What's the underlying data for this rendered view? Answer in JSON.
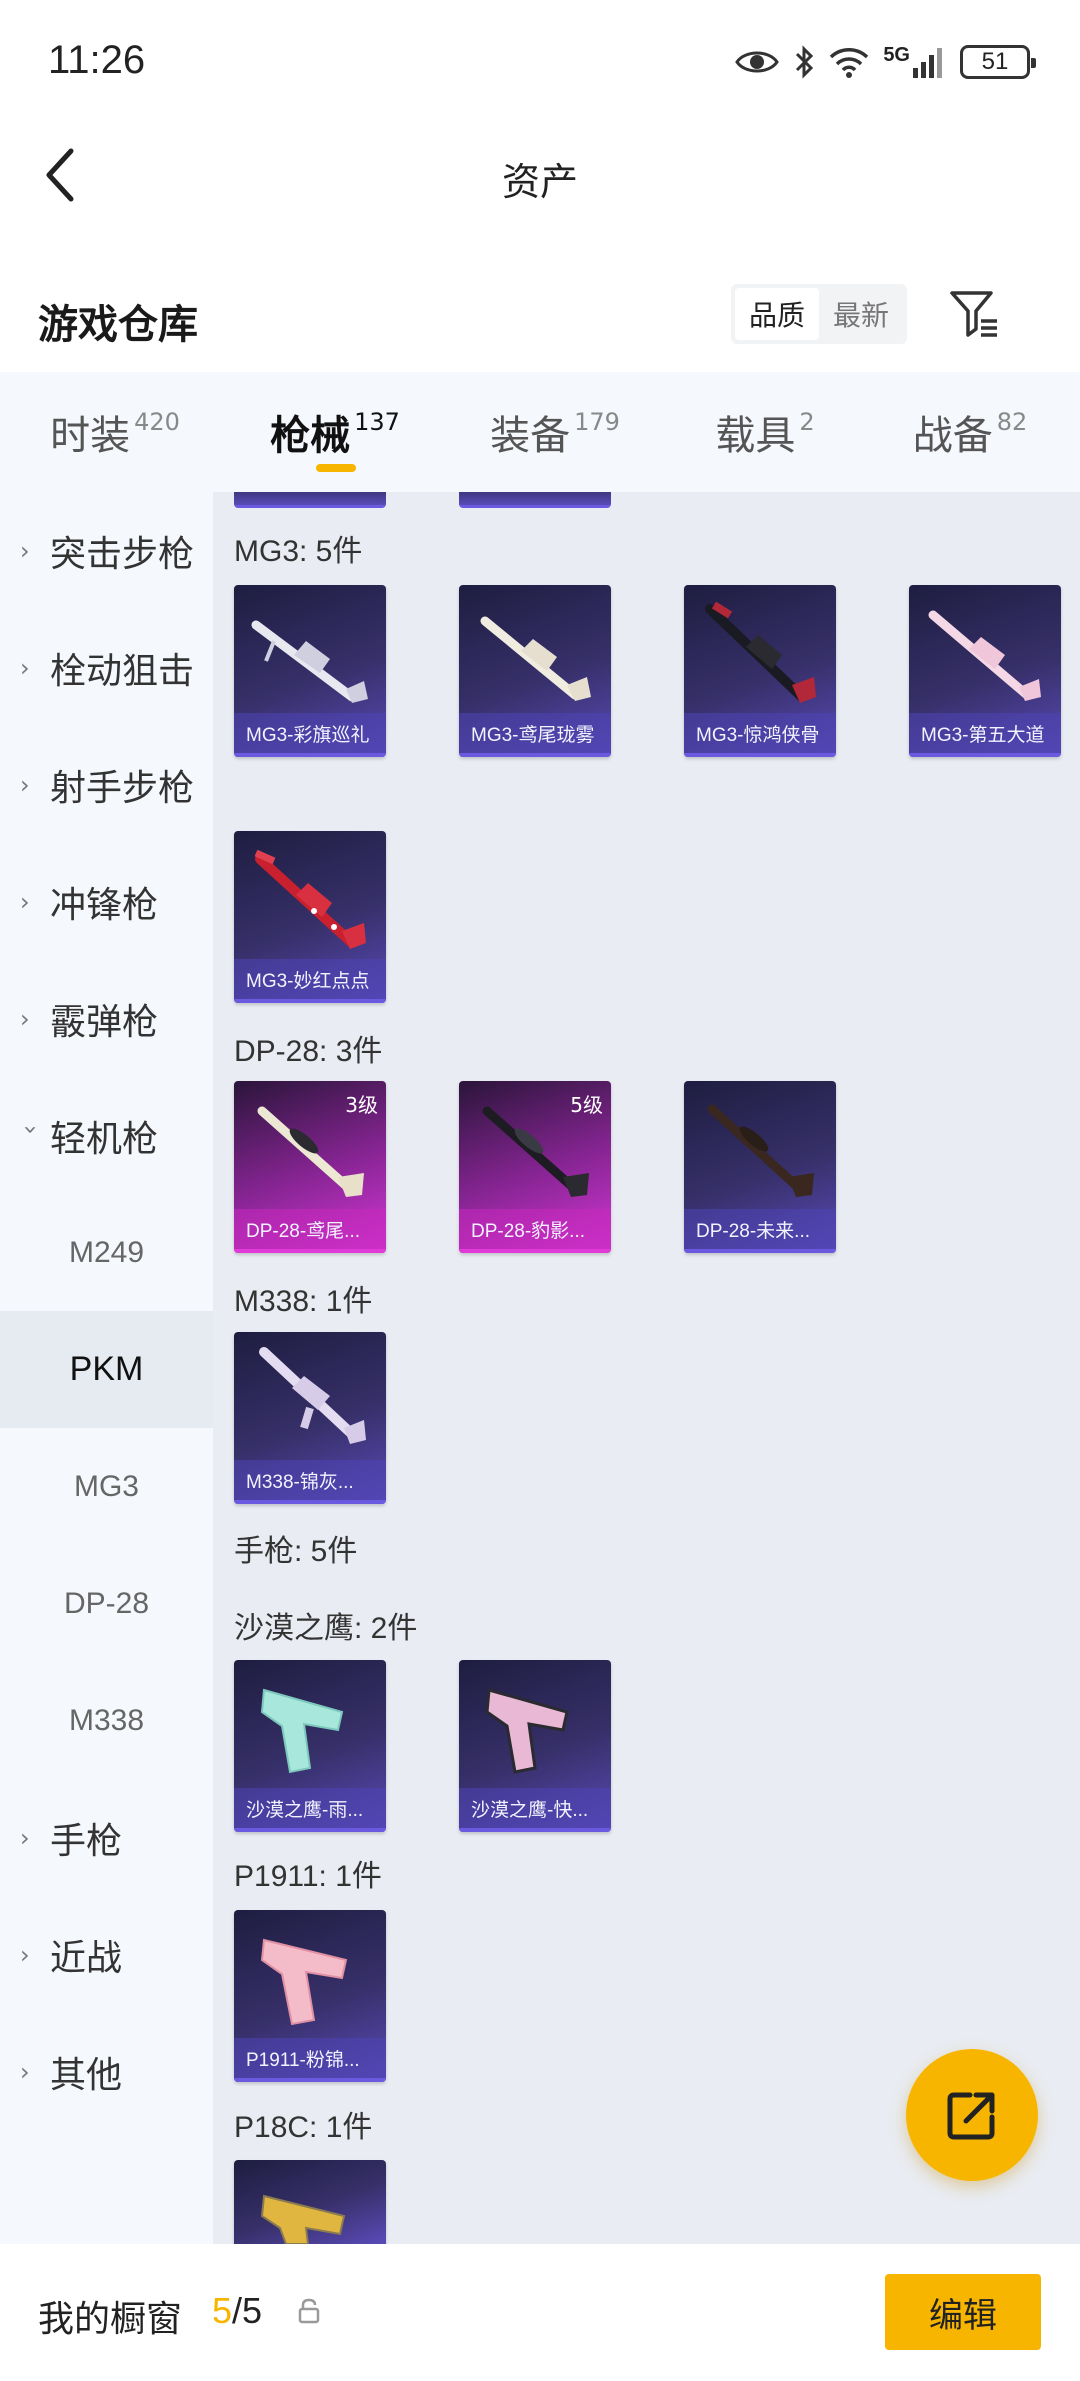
{
  "status_bar": {
    "time": "11:26",
    "network": "5G",
    "battery": "51"
  },
  "header": {
    "title": "资产"
  },
  "warehouse": {
    "title": "游戏仓库",
    "sort_options": [
      "品质",
      "最新"
    ],
    "active_sort": "品质"
  },
  "category_tabs": [
    {
      "label": "时装",
      "count": "420"
    },
    {
      "label": "枪械",
      "count": "137",
      "active": true
    },
    {
      "label": "装备",
      "count": "179"
    },
    {
      "label": "载具",
      "count": "2"
    },
    {
      "label": "战备",
      "count": "82"
    }
  ],
  "sidebar": {
    "items": [
      "突击步枪",
      "栓动狙击",
      "射手步枪",
      "冲锋枪",
      "霰弹枪",
      "轻机枪"
    ],
    "sub_items": [
      "M249",
      "PKM",
      "MG3",
      "DP-28",
      "M338"
    ],
    "active_sub": "PKM",
    "more_items": [
      "手枪",
      "近战",
      "其他"
    ]
  },
  "sections": {
    "mg3": {
      "title": "MG3: 5件",
      "cards": [
        "MG3-彩旗巡礼",
        "MG3-鸢尾珑雾",
        "MG3-惊鸿侠骨",
        "MG3-第五大道",
        "MG3-妙红点点"
      ]
    },
    "dp28": {
      "title": "DP-28: 3件",
      "cards": [
        {
          "name": "DP-28-鸢尾...",
          "level": "3级"
        },
        {
          "name": "DP-28-豹影...",
          "level": "5级"
        },
        {
          "name": "DP-28-未来..."
        }
      ]
    },
    "m338": {
      "title": "M338: 1件",
      "cards": [
        "M338-锦灰..."
      ]
    },
    "pistol": {
      "title": "手枪: 5件"
    },
    "deagle": {
      "title": "沙漠之鹰: 2件",
      "cards": [
        "沙漠之鹰-雨...",
        "沙漠之鹰-快..."
      ]
    },
    "p1911": {
      "title": "P1911: 1件",
      "cards": [
        "P1911-粉锦..."
      ]
    },
    "p18c": {
      "title": "P18C: 1件"
    }
  },
  "bottom_bar": {
    "label": "我的橱窗",
    "current": "5",
    "total": "/5",
    "edit_label": "编辑"
  },
  "colors": {
    "accent": "#f7b500",
    "card_purple": "#5a4ab8",
    "card_pink": "#d338d4"
  }
}
